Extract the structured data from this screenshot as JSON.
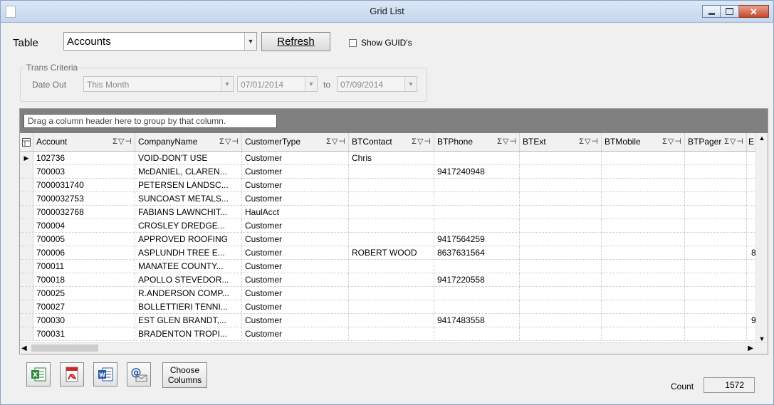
{
  "window": {
    "title": "Grid List"
  },
  "toolbar": {
    "table_label": "Table",
    "table_value": "Accounts",
    "refresh_label": "Refresh",
    "show_guids_label": "Show GUID's"
  },
  "trans": {
    "legend": "Trans Criteria",
    "date_out_label": "Date Out",
    "period_value": "This Month",
    "from_date": "07/01/2014",
    "to_label": "to",
    "to_date": "07/09/2014"
  },
  "grid": {
    "group_hint": "Drag a column header here to group by that column.",
    "columns": [
      {
        "label": "Account"
      },
      {
        "label": "CompanyName"
      },
      {
        "label": "CustomerType"
      },
      {
        "label": "BTContact"
      },
      {
        "label": "BTPhone"
      },
      {
        "label": "BTExt"
      },
      {
        "label": "BTMobile"
      },
      {
        "label": "BTPager"
      },
      {
        "label": "E"
      }
    ],
    "rows": [
      {
        "account": "102736",
        "company": "VOID-DON'T USE",
        "type": "Customer",
        "contact": "Chris",
        "phone": "",
        "extra": ""
      },
      {
        "account": "700003",
        "company": "McDANIEL, CLAREN...",
        "type": "Customer",
        "contact": "",
        "phone": "9417240948",
        "extra": ""
      },
      {
        "account": "7000031740",
        "company": "PETERSEN LANDSC...",
        "type": "Customer",
        "contact": "",
        "phone": "",
        "extra": ""
      },
      {
        "account": "7000032753",
        "company": "SUNCOAST METALS...",
        "type": "Customer",
        "contact": "",
        "phone": "",
        "extra": ""
      },
      {
        "account": "7000032768",
        "company": "FABIANS LAWNCHIT...",
        "type": "HaulAcct",
        "contact": "",
        "phone": "",
        "extra": ""
      },
      {
        "account": "700004",
        "company": "CROSLEY DREDGE...",
        "type": "Customer",
        "contact": "",
        "phone": "",
        "extra": ""
      },
      {
        "account": "700005",
        "company": "APPROVED ROOFING",
        "type": "Customer",
        "contact": "",
        "phone": "9417564259",
        "extra": ""
      },
      {
        "account": "700006",
        "company": "ASPLUNDH TREE E...",
        "type": "Customer",
        "contact": "ROBERT WOOD",
        "phone": "8637631564",
        "extra": "8"
      },
      {
        "account": "700011",
        "company": "MANATEE COUNTY...",
        "type": "Customer",
        "contact": "",
        "phone": "",
        "extra": ""
      },
      {
        "account": "700018",
        "company": "APOLLO STEVEDOR...",
        "type": "Customer",
        "contact": "",
        "phone": "9417220558",
        "extra": ""
      },
      {
        "account": "700025",
        "company": "R.ANDERSON COMP...",
        "type": "Customer",
        "contact": "",
        "phone": "",
        "extra": ""
      },
      {
        "account": "700027",
        "company": "BOLLETTIERI TENNI...",
        "type": "Customer",
        "contact": "",
        "phone": "",
        "extra": ""
      },
      {
        "account": "700030",
        "company": "EST GLEN BRANDT,...",
        "type": "Customer",
        "contact": "",
        "phone": "9417483558",
        "extra": "9"
      },
      {
        "account": "700031",
        "company": "BRADENTON TROPI...",
        "type": "Customer",
        "contact": "",
        "phone": "",
        "extra": ""
      }
    ]
  },
  "footer": {
    "choose_columns_label": "Choose Columns",
    "count_label": "Count",
    "count_value": "1572"
  },
  "icons": {
    "excel": "excel-export-icon",
    "pdf": "pdf-export-icon",
    "word": "word-export-icon",
    "email": "email-icon",
    "column_tools": "sigma-filter-pin-icon"
  }
}
